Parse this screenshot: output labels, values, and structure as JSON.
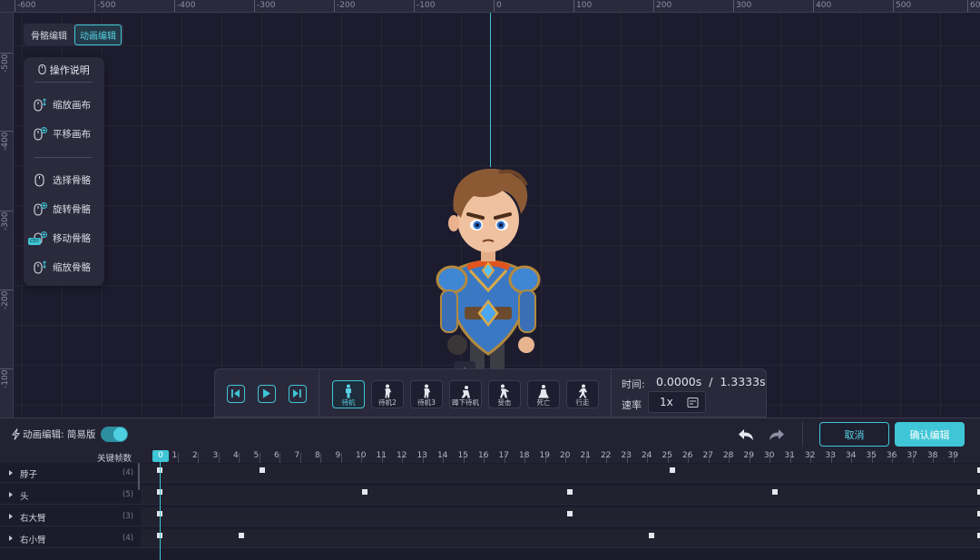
{
  "ruler": {
    "top_labels": [
      "-600",
      "-500",
      "-400",
      "-300",
      "-200",
      "-100",
      "0",
      "100",
      "200",
      "300",
      "400",
      "500",
      "60"
    ],
    "left_labels": [
      "-500",
      "-400",
      "-300",
      "-200",
      "-100"
    ]
  },
  "mode_switch": {
    "bone_edit": "骨骼编辑",
    "anim_edit": "动画编辑"
  },
  "help": {
    "title": "操作说明",
    "items": [
      "缩放画布",
      "平移画布",
      "选择骨骼",
      "旋转骨骼",
      "移动骨骼",
      "缩放骨骼"
    ],
    "ctrl_badge": "ctrl"
  },
  "playbar": {
    "animations": [
      "待机",
      "待机2",
      "待机3",
      "蹲下待机",
      "受击",
      "死亡",
      "行走"
    ],
    "time_label": "时间:",
    "time_value": "0.0000s  /  1.3333s",
    "rate_label": "速率",
    "rate_value": "1x"
  },
  "toolbar": {
    "label": "动画编辑: 简易版",
    "cancel": "取消",
    "confirm": "确认编辑"
  },
  "timeline": {
    "title": "关键帧数",
    "current_frame": "0",
    "frames": [
      "1",
      "2",
      "3",
      "4",
      "5",
      "6",
      "7",
      "8",
      "9",
      "10",
      "11",
      "12",
      "13",
      "14",
      "15",
      "16",
      "17",
      "18",
      "19",
      "20",
      "21",
      "22",
      "23",
      "24",
      "25",
      "26",
      "27",
      "28",
      "29",
      "30",
      "31",
      "32",
      "33",
      "34",
      "35",
      "36",
      "37",
      "38",
      "39"
    ],
    "tracks": [
      {
        "name": "脖子",
        "count": "(4)",
        "keyframes": [
          0,
          5,
          25,
          40
        ]
      },
      {
        "name": "头",
        "count": "(5)",
        "keyframes": [
          0,
          10,
          20,
          30,
          40
        ]
      },
      {
        "name": "右大臂",
        "count": "(3)",
        "keyframes": [
          0,
          20,
          40
        ]
      },
      {
        "name": "右小臂",
        "count": "(4)",
        "keyframes": [
          0,
          4,
          24,
          40
        ]
      }
    ]
  },
  "colors": {
    "accent": "#3fc6d6",
    "background": "#1d1c2e",
    "panel": "#2b2a3c"
  }
}
